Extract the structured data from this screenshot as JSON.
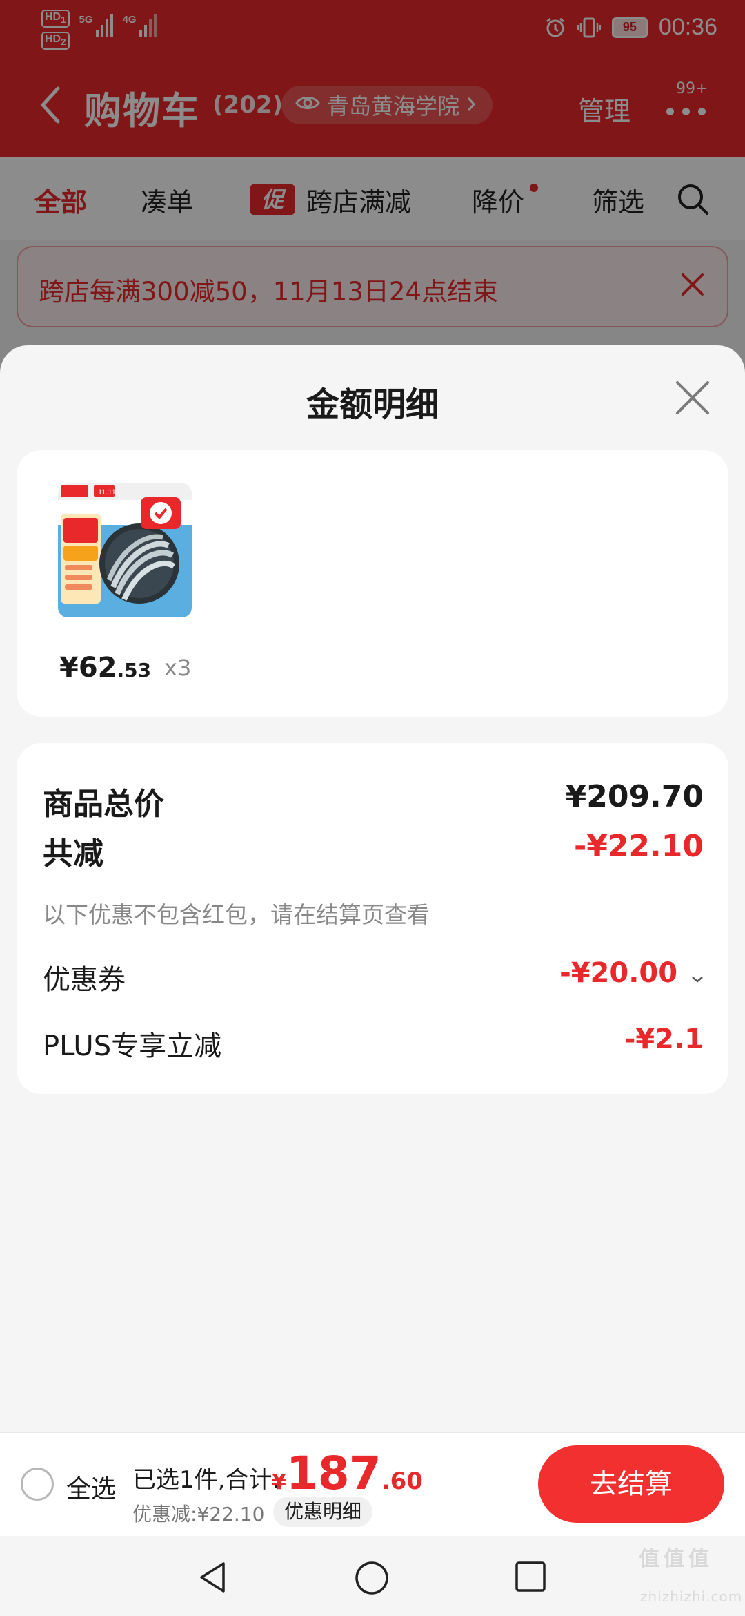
{
  "status_bar": {
    "hd1": "HD",
    "hd1_sub": "1",
    "hd2": "HD",
    "hd2_sub": "2",
    "net1": "5G",
    "net2": "4G",
    "battery": "95",
    "time": "00:36"
  },
  "header": {
    "title": "购物车",
    "count": "(202)",
    "location": "青岛黄海学院",
    "manage": "管理",
    "more_badge": "99+"
  },
  "tabs": [
    {
      "label": "全部",
      "active": true
    },
    {
      "label": "凑单"
    },
    {
      "label": "跨店满减",
      "promo_tag": "促"
    },
    {
      "label": "降价"
    },
    {
      "label": "筛选"
    }
  ],
  "notice": {
    "text": "跨店每满300减50，11月13日24点结束"
  },
  "sheet": {
    "title": "金额明细",
    "product": {
      "price_int": "¥62",
      "price_dec": ".53",
      "qty": "x3",
      "image_tag": "11.11"
    },
    "summary": {
      "total_label": "商品总价",
      "total_value": "¥209.70",
      "discount_label": "共减",
      "discount_value": "-¥22.10",
      "note": "以下优惠不包含红包，请在结算页查看",
      "coupon_label": "优惠券",
      "coupon_value": "-¥20.00",
      "plus_label": "PLUS专享立减",
      "plus_value": "-¥2.1"
    }
  },
  "bottom_bar": {
    "select_all": "全选",
    "selected": "已选1件,合计:",
    "currency": "¥",
    "total_int": "187",
    "total_dec": ".60",
    "saved": "优惠减:¥22.10",
    "detail": "优惠明细",
    "checkout": "去结算"
  },
  "watermark": {
    "text": "值值值",
    "domain": "zhizhizhi.com"
  },
  "colors": {
    "brand_red": "#e9282b",
    "checkout": "#f2302f"
  }
}
